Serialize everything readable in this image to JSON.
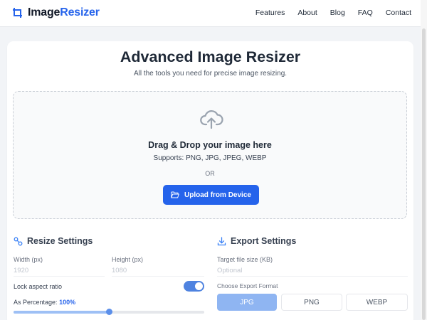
{
  "header": {
    "brand_part1": "Image",
    "brand_part2": "Resizer",
    "nav": [
      "Features",
      "About",
      "Blog",
      "FAQ",
      "Contact"
    ]
  },
  "main": {
    "title": "Advanced Image Resizer",
    "subtitle": "All the tools you need for precise image resizing."
  },
  "dropzone": {
    "title": "Drag & Drop your image here",
    "formats": "Supports: PNG, JPG, JPEG, WEBP",
    "or": "OR",
    "upload_label": "Upload from Device"
  },
  "resize": {
    "title": "Resize Settings",
    "width_label": "Width (px)",
    "width_placeholder": "1920",
    "height_label": "Height (px)",
    "height_placeholder": "1080",
    "lock_label": "Lock aspect ratio",
    "lock_on": true,
    "percentage_label": "As Percentage:",
    "percentage_value": "100%",
    "percentage_fraction": 0.5
  },
  "export": {
    "title": "Export Settings",
    "target_label": "Target file size (KB)",
    "target_placeholder": "Optional",
    "format_label": "Choose Export Format",
    "formats": [
      "JPG",
      "PNG",
      "WEBP"
    ],
    "selected_format": "JPG"
  },
  "icons": {
    "brand": "crop-frame-icon",
    "dropzone": "cloud-upload-icon",
    "upload_button": "folder-open-icon",
    "resize": "link-icon",
    "export": "download-icon"
  },
  "colors": {
    "accent": "#2563eb",
    "active_format": "#8fb5f2",
    "toggle_on": "#4f83e0",
    "background": "#f2f4f7"
  }
}
